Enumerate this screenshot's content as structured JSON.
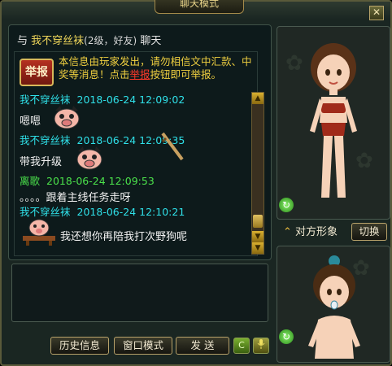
{
  "window": {
    "title": "聊天模式",
    "close_label": "✕"
  },
  "header": {
    "prefix": "与",
    "name": "我不穿丝袜",
    "level": "(2级，好友)",
    "suffix": "聊天"
  },
  "notice": {
    "report_label": "举报",
    "text_before": "本信息由玩家发出，请勿相信文中汇款、中奖等消息！点击",
    "link": "举报",
    "text_after": "按钮即可举报。"
  },
  "messages": [
    {
      "sender": "我不穿丝袜",
      "time": "2018-06-24 12:09:02",
      "text": "嗯嗯",
      "sender_color": "cyan"
    },
    {
      "sender": "我不穿丝袜",
      "time": "2018-06-24 12:09:35",
      "text": "带我升级",
      "sender_color": "cyan"
    },
    {
      "sender": "离歌",
      "time": "2018-06-24 12:09:53",
      "text": "。。。。跟着主线任务走呀",
      "sender_color": "green"
    },
    {
      "sender": "我不穿丝袜",
      "time": "2018-06-24 12:10:21",
      "text": "我还想你再陪我打次野狗呢",
      "sender_color": "cyan"
    }
  ],
  "buttons": {
    "history": "历史信息",
    "window_mode": "窗口模式",
    "send": "发 送",
    "c_label": "C"
  },
  "right": {
    "other_label": "对方形象",
    "switch_label": "切换"
  },
  "colors": {
    "cyan": "#2fe0e8",
    "green": "#4be24b",
    "notice": "#f0d040",
    "link": "#ff3a2a"
  }
}
